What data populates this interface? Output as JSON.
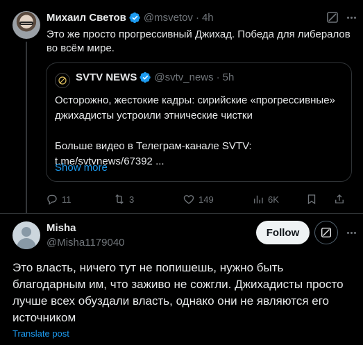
{
  "tweet": {
    "author_name": "Михаил Светов",
    "author_handle": "@msvetov",
    "separator": "·",
    "time": "4h",
    "text": "Это же просто прогрессивный Джихад. Победа для либералов во всём мире.",
    "quote": {
      "author_name": "SVTV NEWS",
      "author_handle": "@svtv_news",
      "time": "5h",
      "line1": "Осторожно, жестокие кадры: сирийские «прогрессивные» джихадисты устроили этнические чистки",
      "line2": "Больше видео в Телеграм-канале SVTV: t.me/svtvnews/67392 ...",
      "show_more": "Show more"
    },
    "stats": {
      "replies": "11",
      "reposts": "3",
      "likes": "149",
      "views": "6K"
    }
  },
  "reply": {
    "author_name": "Misha",
    "author_handle": "@Misha1179040",
    "follow_label": "Follow",
    "text": "Это власть, ничего тут не попишешь, нужно быть благодарным им, что заживо не сожгли. Джихадисты просто лучше всех обуздали власть, однако они не являются его источником",
    "translate_label": "Translate post"
  },
  "colors": {
    "background": "#000000",
    "text_primary": "#e7e9ea",
    "text_secondary": "#71767b",
    "link": "#1d9bf0",
    "verified": "#1d9bf0",
    "border": "#2f3336"
  }
}
